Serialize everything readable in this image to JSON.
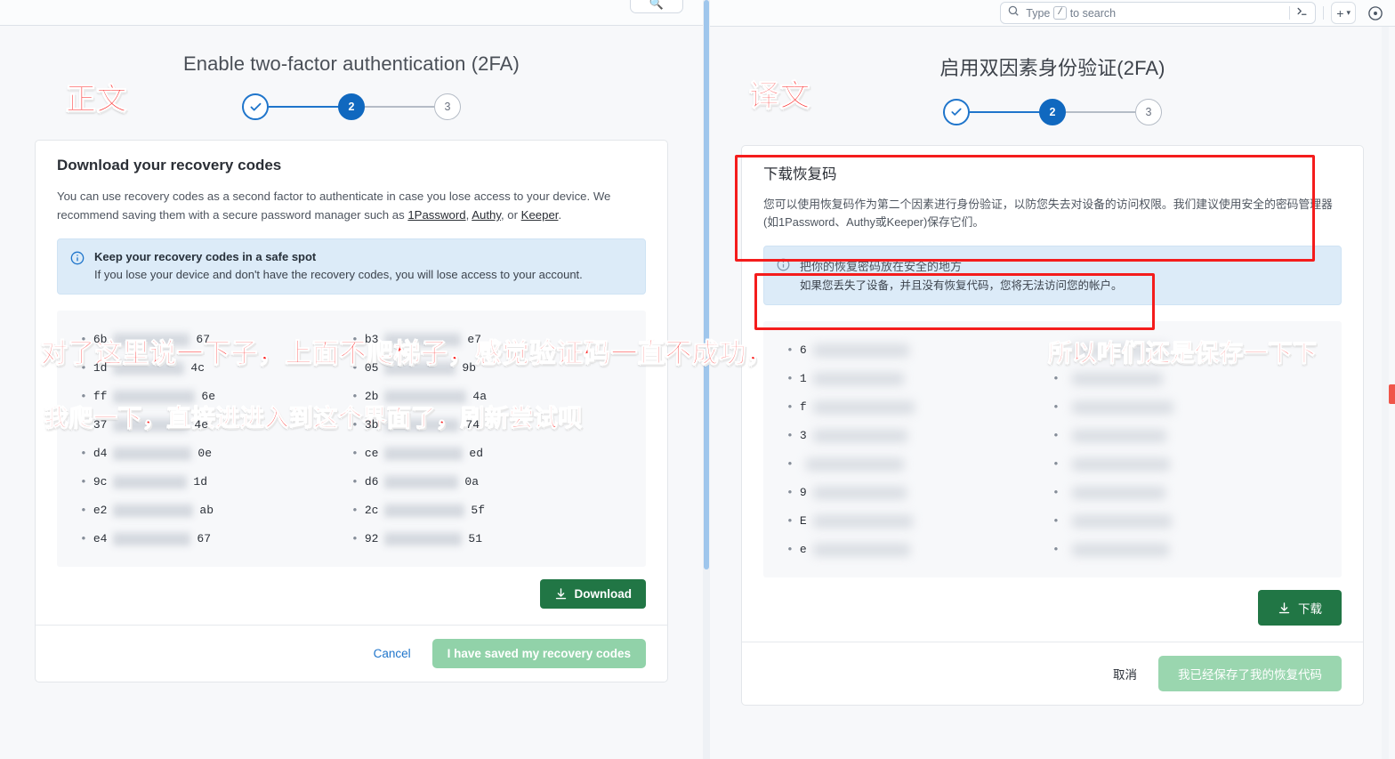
{
  "topbar": {
    "search_placeholder": "Type",
    "search_placeholder_tail": "to search",
    "search_key": "/",
    "terminal_icon": ">_",
    "plus_label": "+",
    "chevron": "▾",
    "avatar_icon": "user-circle-icon"
  },
  "original": {
    "label": "正文",
    "page_title": "Enable two-factor authentication (2FA)",
    "stepper": {
      "step1": "✓",
      "step2": "2",
      "step3": "3"
    },
    "card": {
      "heading": "Download your recovery codes",
      "paragraph_1": "You can use recovery codes as a second factor to authenticate in case you lose access to your device. We recommend saving them with a secure password manager such as ",
      "link_1": "1Password",
      "sep_1": ", ",
      "link_2": "Authy",
      "sep_2": ", or ",
      "link_3": "Keeper",
      "paragraph_end": ".",
      "alert_title": "Keep your recovery codes in a safe spot",
      "alert_text": "If you lose your device and don't have the recovery codes, you will lose access to your account.",
      "download_label": "Download",
      "download_icon": "download-icon",
      "cancel_label": "Cancel",
      "confirm_label": "I have saved my recovery codes"
    },
    "codes_left": [
      {
        "prefix": "6b",
        "suffix": "67"
      },
      {
        "prefix": "1d",
        "suffix": "4c"
      },
      {
        "prefix": "ff",
        "suffix": "6e"
      },
      {
        "prefix": "37",
        "suffix": "4e"
      },
      {
        "prefix": "d4",
        "suffix": "0e"
      },
      {
        "prefix": "9c",
        "suffix": "1d"
      },
      {
        "prefix": "e2",
        "suffix": "ab"
      },
      {
        "prefix": "e4",
        "suffix": "67"
      }
    ],
    "codes_right": [
      {
        "prefix": "b3",
        "suffix": "e7"
      },
      {
        "prefix": "05",
        "suffix": "9b"
      },
      {
        "prefix": "2b",
        "suffix": "4a"
      },
      {
        "prefix": "3b",
        "suffix": "74"
      },
      {
        "prefix": "ce",
        "suffix": "ed"
      },
      {
        "prefix": "d6",
        "suffix": "0a"
      },
      {
        "prefix": "2c",
        "suffix": "5f"
      },
      {
        "prefix": "92",
        "suffix": "51"
      }
    ]
  },
  "translation": {
    "label": "译文",
    "page_title": "启用双因素身份验证(2FA)",
    "stepper": {
      "step1": "✓",
      "step2": "2",
      "step3": "3"
    },
    "card": {
      "heading": "下载恢复码",
      "paragraph": "您可以使用恢复码作为第二个因素进行身份验证，以防您失去对设备的访问权限。我们建议使用安全的密码管理器(如1Password、Authy或Keeper)保存它们。",
      "alert_title": "把你的恢复密码放在安全的地方",
      "alert_text": "如果您丢失了设备，并且没有恢复代码，您将无法访问您的帐户。",
      "download_label": "下载",
      "download_icon": "download-icon",
      "cancel_label": "取消",
      "confirm_label": "我已经保存了我的恢复代码"
    },
    "codes_left": [
      {
        "prefix": "6",
        "suffix": ""
      },
      {
        "prefix": "1",
        "suffix": ""
      },
      {
        "prefix": "f",
        "suffix": ""
      },
      {
        "prefix": "3",
        "suffix": ""
      },
      {
        "prefix": "",
        "suffix": ""
      },
      {
        "prefix": "9",
        "suffix": ""
      },
      {
        "prefix": "E",
        "suffix": ""
      },
      {
        "prefix": "e",
        "suffix": ""
      }
    ],
    "codes_right": [
      {
        "prefix": "",
        "suffix": ""
      },
      {
        "prefix": "",
        "suffix": ""
      },
      {
        "prefix": "",
        "suffix": ""
      },
      {
        "prefix": "",
        "suffix": ""
      },
      {
        "prefix": "",
        "suffix": ""
      },
      {
        "prefix": "",
        "suffix": ""
      },
      {
        "prefix": "",
        "suffix": ""
      },
      {
        "prefix": "",
        "suffix": ""
      }
    ]
  },
  "annotations": {
    "line_1": "对了这里说一下子，上面不爬梯子，感觉验证码一直不成功，",
    "line_2": "我爬一下，直接进进入到这个界面了，刷新尝试呗",
    "line_3": "所以咋们还是保存一下下"
  },
  "colors": {
    "brand_blue": "#1068bf",
    "link_blue": "#1f75cb",
    "download_green": "#217645",
    "disabled_green": "#91d2a9",
    "annotation_red": "#fb1e1e",
    "redbox": "#f41c1c",
    "alert_bg": "#dcebf8"
  }
}
